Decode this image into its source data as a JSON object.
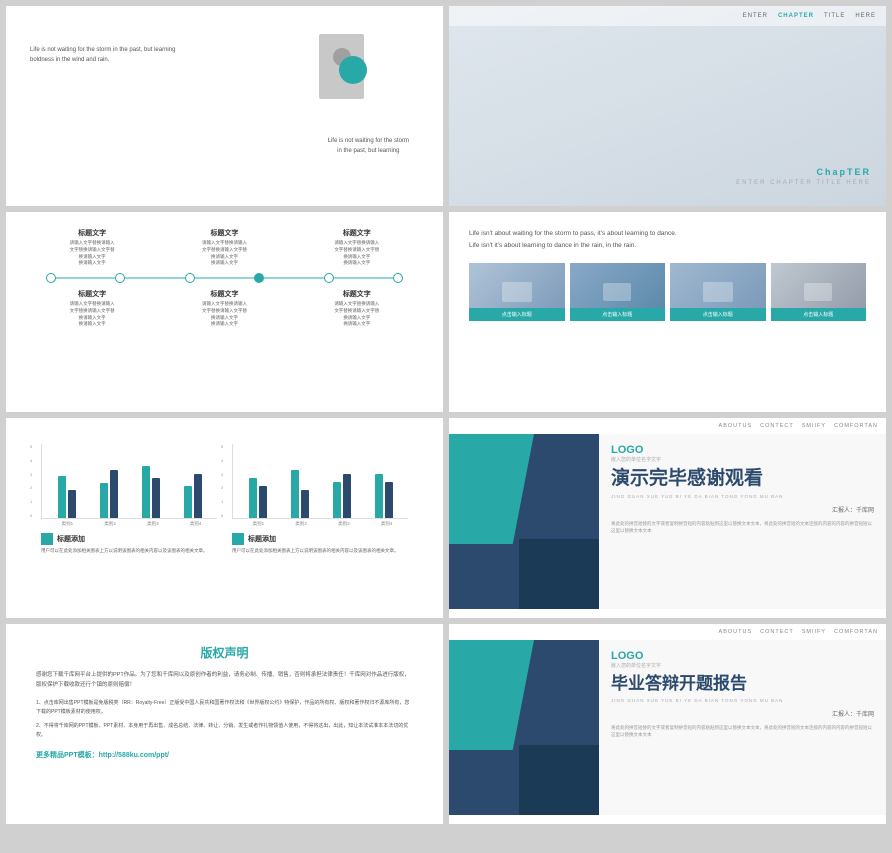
{
  "slides": [
    {
      "id": "slide-1",
      "quote1": "Life is not waiting for the storm in the past, but learning boldness in the wind and rain.",
      "quote2": "Life is not waiting for the storm\nin the past, but learning"
    },
    {
      "id": "slide-2",
      "nav_items": [
        "ENTER",
        "CHAPTER",
        "TITLE",
        "HERE"
      ],
      "chapter_label": "ChapTER",
      "title_line": "ENTER CHAPTER TITLE HERE"
    },
    {
      "id": "slide-3",
      "timeline_items_top": [
        {
          "title": "标题文字",
          "lines": [
            "请输入文字替换请输入",
            "文字替换请输入文字替",
            "换请输入文字",
            "换请输入文字"
          ]
        },
        {
          "title": "标题文字",
          "lines": [
            "请输入文字替换请输入",
            "文字替换请输入文字替",
            "换请输入文字",
            "换请输入文字"
          ]
        },
        {
          "title": "标题文字",
          "lines": [
            "请输入文字替换请输入",
            "文字替换请输入文字替",
            "换请输入文字",
            "换请输入文字"
          ]
        }
      ],
      "timeline_items_bottom": [
        {
          "title": "标题文字",
          "lines": [
            "请输入文字替换请输入",
            "文字替换请输入文字替",
            "换请输入文字",
            "换请输入文字"
          ]
        },
        {
          "title": "标题文字",
          "lines": [
            "请输入文字替换请输入",
            "文字替换请输入文字替",
            "换请输入文字",
            "换请输入文字"
          ]
        },
        {
          "title": "标题文字",
          "lines": [
            "请输入文字替换请输入",
            "文字替换请输入文字替",
            "换请输入文字",
            "换请输入文字"
          ]
        }
      ]
    },
    {
      "id": "slide-4",
      "quote_line1": "Life isn't about waiting for the storm to pass, it's about learning to dance.",
      "quote_line2": "Life isn't it's about learning to dance in the rain, in the rain.",
      "image_captions": [
        "点击输入标题",
        "点击输入标题",
        "点击输入标题",
        "点击输入标题"
      ]
    },
    {
      "id": "slide-5",
      "chart1": {
        "title": "标题添加",
        "desc": "用户可以在此处添加相关图表上方以说明该图表的相关内容以及该图表的相关文章。",
        "bars": [
          {
            "label": "类别1",
            "v1": 55,
            "v2": 35
          },
          {
            "label": "类别2",
            "v1": 45,
            "v2": 60
          },
          {
            "label": "类别3",
            "v1": 65,
            "v2": 50
          },
          {
            "label": "类别4",
            "v1": 40,
            "v2": 55
          }
        ]
      },
      "chart2": {
        "title": "标题添加",
        "desc": "用户可以在此处添加相关图表上方以说明该图表的相关内容以及该图表的相关文章。",
        "bars": [
          {
            "label": "类别1",
            "v1": 50,
            "v2": 40
          },
          {
            "label": "类别2",
            "v1": 60,
            "v2": 35
          },
          {
            "label": "类别3",
            "v1": 45,
            "v2": 55
          },
          {
            "label": "类别4",
            "v1": 55,
            "v2": 45
          }
        ]
      }
    },
    {
      "id": "slide-6",
      "nav_items": [
        "ABOUTUS",
        "CONTECT",
        "SMIIFY",
        "COMFORTAN"
      ],
      "logo": "LOGO",
      "logo_sub": "嵌入您的单位名字文字",
      "main_title": "演示完毕感谢观看",
      "pinyin": "JING GUAN XUE YUE BI YE DA BIAN TONG YONG MU BAN",
      "author": "汇报人：千库网",
      "desc": "将此处的拼音短替的文字或者复制拼音短的内容粘贴到这里以替换文本文本，将此处的拼音短的文本连接的内容的内容的拼音短短以这里以替换文本文本"
    },
    {
      "id": "slide-7",
      "title": "版权声明",
      "para1": "感谢您下载千库网平台上提供的PPT作品。为了您和千库网以及原创作者的利益，请务必制、传播、销售，否则将承担法律责任！千库网对作品进行版权，版权保护下载收款还行个镇的原则赔偿！",
      "para2_label": "1、点击库网出售PPT模板是免版税类（RR：Royalty-Free）正版受中国人民共和国著作权法和《世界版权公约》特保护，作品的所有权、版权和著作权归不源库所有，您下载的PPT模板素材的使用权。",
      "para3_label": "2、不得将千库网的PPT模板、PPT素材、本身用于再出售、成名总结、法律、转让、分销、发生或者作礼物馈值人使用，不得将这出，出此，知让本法试准本本法切的优权。",
      "link_label": "更多精品PPT模板：http://588ku.com/ppt/"
    },
    {
      "id": "slide-8",
      "nav_items": [
        "ABOUTUS",
        "CONTECT",
        "SMIIFY",
        "COMFORTAN"
      ],
      "logo": "LOGO",
      "logo_sub": "嵌入您的单位名字文字",
      "main_title": "毕业答辩开题报告",
      "pinyin": "JING GUAN XUE YUE BI YE DA BIAN TONG YONG MU BAN",
      "author": "汇报人：千库网",
      "desc": "将此处的拼音短替的文字或者复制拼音短的内容粘贴到这里以替换文本文本，将此处的拼音短的文本连接的内容的内容的拼音短短以这里以替换文本文本"
    }
  ]
}
